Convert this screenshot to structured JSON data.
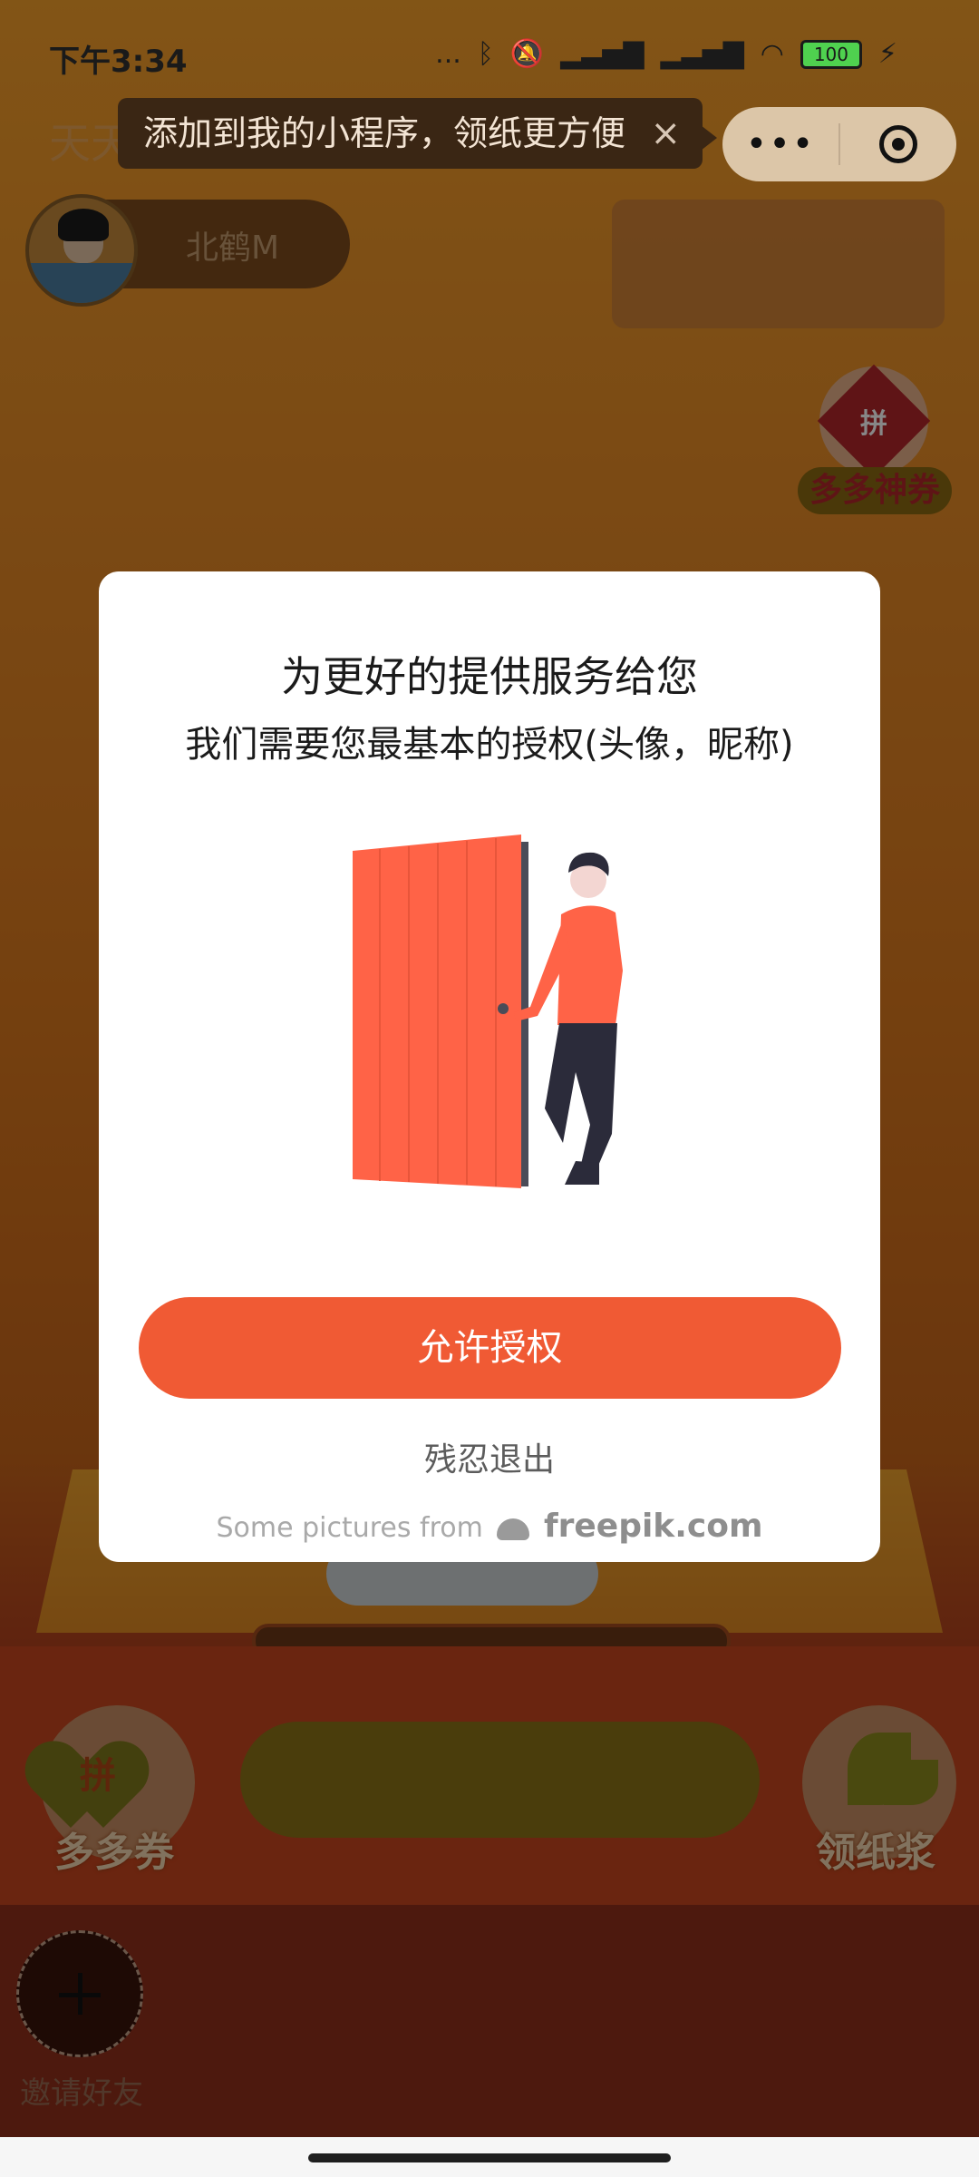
{
  "status_bar": {
    "time": "下午3:34",
    "signal_dots": "...",
    "battery_level": "100"
  },
  "header": {
    "app_title": "天天",
    "tooltip_text": "添加到我的小程序，领纸更方便",
    "tooltip_close": "×",
    "capsule_more": "•••"
  },
  "user": {
    "name": "北鹤M"
  },
  "side_coupon": {
    "badge_char": "拼",
    "label": "多多神券"
  },
  "bottom": {
    "left_button_char": "拼",
    "left_button_label": "多多券",
    "right_button_label": "领纸浆",
    "invite_label": "邀请好友"
  },
  "dialog": {
    "title": "为更好的提供服务给您",
    "subtitle": "我们需要您最基本的授权(头像，昵称)",
    "allow_button": "允许授权",
    "exit_link": "残忍退出",
    "credit_prefix": "Some pictures from",
    "credit_brand": "freepik.com"
  },
  "colors": {
    "accent": "#f05a34",
    "background_orange": "#e98d27",
    "dialog_bg": "#ffffff"
  }
}
